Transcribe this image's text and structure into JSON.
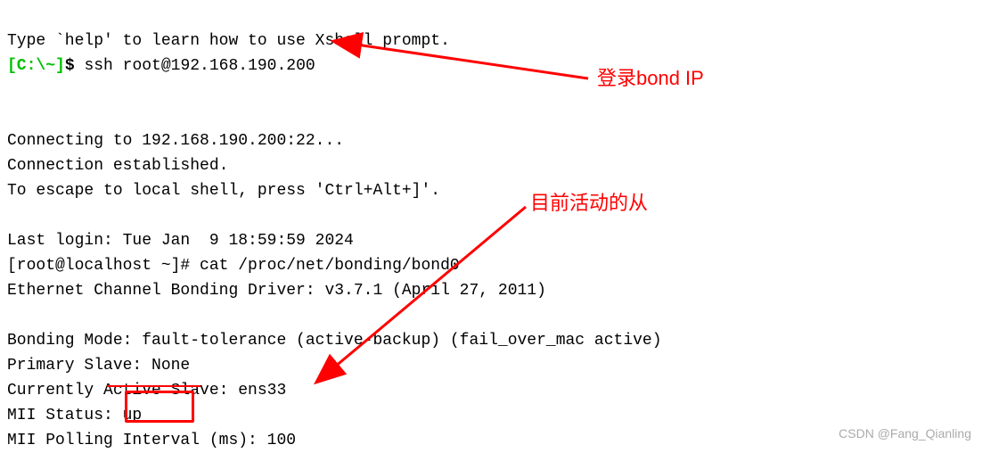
{
  "terminal": {
    "line0": "Type `help' to learn how to use Xshell prompt.",
    "prompt_local": "[C:\\~]",
    "dollar": "$",
    "cmd1": "ssh root@192.168.190.200",
    "blank": "",
    "line3": "Connecting to 192.168.190.200:22...",
    "line4": "Connection established.",
    "line5": "To escape to local shell, press 'Ctrl+Alt+]'.",
    "line7": "Last login: Tue Jan  9 18:59:59 2024",
    "line8": "[root@localhost ~]# cat /proc/net/bonding/bond0",
    "line9": "Ethernet Channel Bonding Driver: v3.7.1 (April 27, 2011)",
    "line11": "Bonding Mode: fault-tolerance (active-backup) (fail_over_mac active)",
    "line12": "Primary Slave: None",
    "line13": "Currently Active Slave: ens33",
    "line14": "MII Status: up",
    "line15": "MII Polling Interval (ms): 100"
  },
  "annotations": {
    "label1": "登录bond IP",
    "label2": "目前活动的从"
  },
  "watermark": "CSDN @Fang_Qianling",
  "colors": {
    "red": "#ff0000",
    "green": "#00c000"
  }
}
